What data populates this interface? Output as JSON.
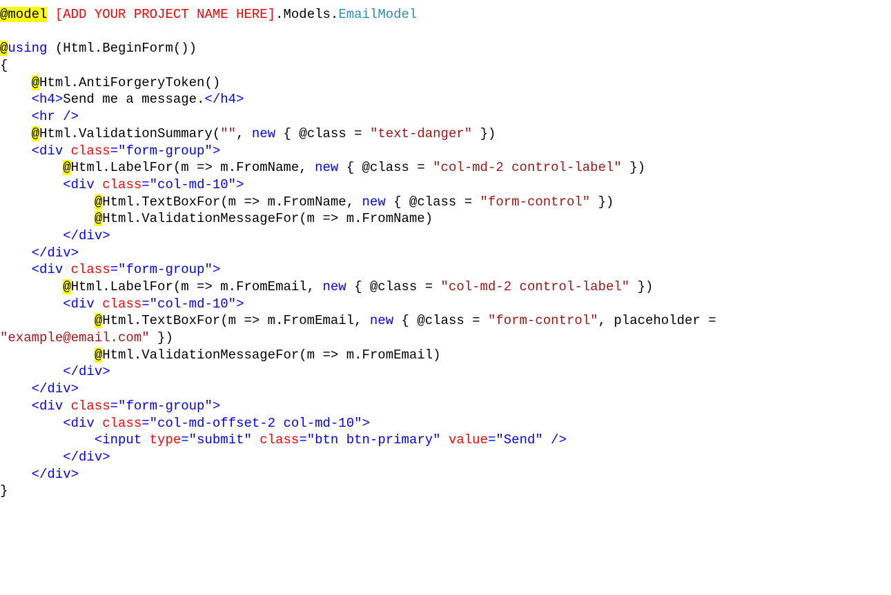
{
  "editor": {
    "colors": {
      "background": "#ffffff",
      "plain": "#000000",
      "keyword_and_tags": "#0000ff",
      "string": "#a31515",
      "type": "#2b91af",
      "attribute": "#ff0000",
      "razor_highlight": "#ffff00"
    },
    "lines": [
      [
        {
          "t": "hl",
          "v": "@model"
        },
        {
          "t": "plain",
          "v": " "
        },
        {
          "t": "attr",
          "v": "[ADD YOUR PROJECT NAME HERE]"
        },
        {
          "t": "plain",
          "v": ".Models."
        },
        {
          "t": "type",
          "v": "EmailModel"
        }
      ],
      [],
      [
        {
          "t": "hl",
          "v": "@"
        },
        {
          "t": "kw",
          "v": "using"
        },
        {
          "t": "plain",
          "v": " (Html.BeginForm())"
        }
      ],
      [
        {
          "t": "plain",
          "v": "{"
        }
      ],
      [
        {
          "t": "plain",
          "v": "    "
        },
        {
          "t": "hl",
          "v": "@"
        },
        {
          "t": "plain",
          "v": "Html.AntiForgeryToken()"
        }
      ],
      [
        {
          "t": "plain",
          "v": "    "
        },
        {
          "t": "kw",
          "v": "<h4>"
        },
        {
          "t": "plain",
          "v": "Send me a message."
        },
        {
          "t": "kw",
          "v": "</h4>"
        }
      ],
      [
        {
          "t": "plain",
          "v": "    "
        },
        {
          "t": "kw",
          "v": "<hr />"
        }
      ],
      [
        {
          "t": "plain",
          "v": "    "
        },
        {
          "t": "hl",
          "v": "@"
        },
        {
          "t": "plain",
          "v": "Html.ValidationSummary("
        },
        {
          "t": "str",
          "v": "\"\""
        },
        {
          "t": "plain",
          "v": ", "
        },
        {
          "t": "kw",
          "v": "new"
        },
        {
          "t": "plain",
          "v": " { @class = "
        },
        {
          "t": "str",
          "v": "\"text-danger\""
        },
        {
          "t": "plain",
          "v": " })"
        }
      ],
      [
        {
          "t": "plain",
          "v": "    "
        },
        {
          "t": "kw",
          "v": "<div "
        },
        {
          "t": "attr",
          "v": "class"
        },
        {
          "t": "kw",
          "v": "=\"form-group\">"
        }
      ],
      [
        {
          "t": "plain",
          "v": "        "
        },
        {
          "t": "hl",
          "v": "@"
        },
        {
          "t": "plain",
          "v": "Html.LabelFor(m => m.FromName, "
        },
        {
          "t": "kw",
          "v": "new"
        },
        {
          "t": "plain",
          "v": " { @class = "
        },
        {
          "t": "str",
          "v": "\"col-md-2 control-label\""
        },
        {
          "t": "plain",
          "v": " })"
        }
      ],
      [
        {
          "t": "plain",
          "v": "        "
        },
        {
          "t": "kw",
          "v": "<div "
        },
        {
          "t": "attr",
          "v": "class"
        },
        {
          "t": "kw",
          "v": "=\"col-md-10\">"
        }
      ],
      [
        {
          "t": "plain",
          "v": "            "
        },
        {
          "t": "hl",
          "v": "@"
        },
        {
          "t": "plain",
          "v": "Html.TextBoxFor(m => m.FromName, "
        },
        {
          "t": "kw",
          "v": "new"
        },
        {
          "t": "plain",
          "v": " { @class = "
        },
        {
          "t": "str",
          "v": "\"form-control\""
        },
        {
          "t": "plain",
          "v": " })"
        }
      ],
      [
        {
          "t": "plain",
          "v": "            "
        },
        {
          "t": "hl",
          "v": "@"
        },
        {
          "t": "plain",
          "v": "Html.ValidationMessageFor(m => m.FromName)"
        }
      ],
      [
        {
          "t": "plain",
          "v": "        "
        },
        {
          "t": "kw",
          "v": "</div>"
        }
      ],
      [
        {
          "t": "plain",
          "v": "    "
        },
        {
          "t": "kw",
          "v": "</div>"
        }
      ],
      [
        {
          "t": "plain",
          "v": "    "
        },
        {
          "t": "kw",
          "v": "<div "
        },
        {
          "t": "attr",
          "v": "class"
        },
        {
          "t": "kw",
          "v": "=\"form-group\">"
        }
      ],
      [
        {
          "t": "plain",
          "v": "        "
        },
        {
          "t": "hl",
          "v": "@"
        },
        {
          "t": "plain",
          "v": "Html.LabelFor(m => m.FromEmail, "
        },
        {
          "t": "kw",
          "v": "new"
        },
        {
          "t": "plain",
          "v": " { @class = "
        },
        {
          "t": "str",
          "v": "\"col-md-2 control-label\""
        },
        {
          "t": "plain",
          "v": " })"
        }
      ],
      [
        {
          "t": "plain",
          "v": "        "
        },
        {
          "t": "kw",
          "v": "<div "
        },
        {
          "t": "attr",
          "v": "class"
        },
        {
          "t": "kw",
          "v": "=\"col-md-10\">"
        }
      ],
      [
        {
          "t": "plain",
          "v": "            "
        },
        {
          "t": "hl",
          "v": "@"
        },
        {
          "t": "plain",
          "v": "Html.TextBoxFor(m => m.FromEmail, "
        },
        {
          "t": "kw",
          "v": "new"
        },
        {
          "t": "plain",
          "v": " { @class = "
        },
        {
          "t": "str",
          "v": "\"form-control\""
        },
        {
          "t": "plain",
          "v": ", placeholder ="
        }
      ],
      [
        {
          "t": "str",
          "v": "\"example@email.com\""
        },
        {
          "t": "plain",
          "v": " })"
        }
      ],
      [
        {
          "t": "plain",
          "v": "            "
        },
        {
          "t": "hl",
          "v": "@"
        },
        {
          "t": "plain",
          "v": "Html.ValidationMessageFor(m => m.FromEmail)"
        }
      ],
      [
        {
          "t": "plain",
          "v": "        "
        },
        {
          "t": "kw",
          "v": "</div>"
        }
      ],
      [
        {
          "t": "plain",
          "v": "    "
        },
        {
          "t": "kw",
          "v": "</div>"
        }
      ],
      [
        {
          "t": "plain",
          "v": "    "
        },
        {
          "t": "kw",
          "v": "<div "
        },
        {
          "t": "attr",
          "v": "class"
        },
        {
          "t": "kw",
          "v": "=\"form-group\">"
        }
      ],
      [
        {
          "t": "plain",
          "v": "        "
        },
        {
          "t": "kw",
          "v": "<div "
        },
        {
          "t": "attr",
          "v": "class"
        },
        {
          "t": "kw",
          "v": "=\"col-md-offset-2 col-md-10\">"
        }
      ],
      [
        {
          "t": "plain",
          "v": "            "
        },
        {
          "t": "kw",
          "v": "<input "
        },
        {
          "t": "attr",
          "v": "type"
        },
        {
          "t": "kw",
          "v": "=\"submit\" "
        },
        {
          "t": "attr",
          "v": "class"
        },
        {
          "t": "kw",
          "v": "=\"btn btn-primary\" "
        },
        {
          "t": "attr",
          "v": "value"
        },
        {
          "t": "kw",
          "v": "=\"Send\" />"
        }
      ],
      [
        {
          "t": "plain",
          "v": "        "
        },
        {
          "t": "kw",
          "v": "</div>"
        }
      ],
      [
        {
          "t": "plain",
          "v": "    "
        },
        {
          "t": "kw",
          "v": "</div>"
        }
      ],
      [
        {
          "t": "plain",
          "v": "}"
        }
      ]
    ]
  }
}
